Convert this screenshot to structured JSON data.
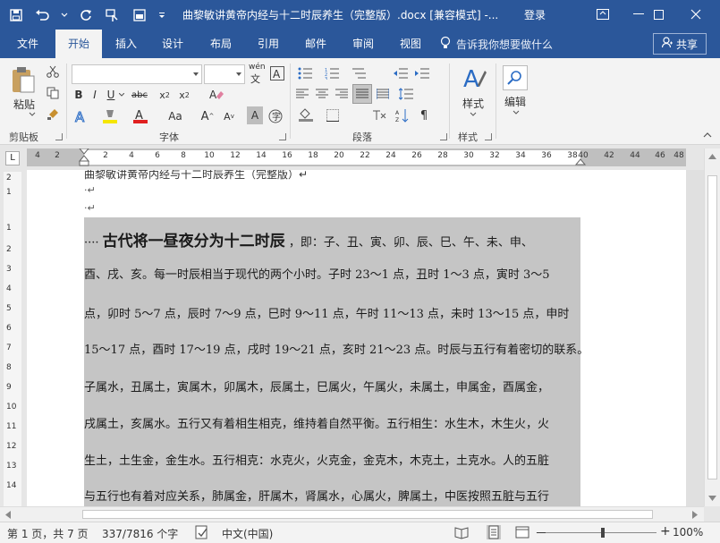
{
  "window": {
    "title": "曲黎敏讲黄帝内经与十二时辰养生（完整版）.docx [兼容模式] -...",
    "login": "登录"
  },
  "ribbon_tabs": [
    "文件",
    "开始",
    "插入",
    "设计",
    "布局",
    "引用",
    "邮件",
    "审阅",
    "视图"
  ],
  "active_tab": "开始",
  "tell_me": "告诉我你想要做什么",
  "share": "共享",
  "groups": {
    "clipboard": {
      "label": "剪贴板",
      "paste": "粘贴"
    },
    "font": {
      "label": "字体",
      "wen": "wén"
    },
    "paragraph": {
      "label": "段落"
    },
    "styles": {
      "label": "样式",
      "button": "样式"
    },
    "editing": {
      "button": "编辑"
    }
  },
  "ruler": {
    "corner": "L",
    "h_left": [
      "4",
      "2"
    ],
    "h_main": [
      "2",
      "4",
      "6",
      "8",
      "10",
      "12",
      "14",
      "16",
      "18",
      "20",
      "22",
      "24",
      "26",
      "28",
      "30",
      "32",
      "34",
      "36",
      "38"
    ],
    "h_right": [
      "40",
      "42",
      "44",
      "46",
      "48"
    ],
    "v": [
      "2",
      "1",
      "1",
      "2",
      "3",
      "4",
      "5",
      "6",
      "7",
      "8",
      "9",
      "10",
      "11",
      "12",
      "13",
      "14"
    ]
  },
  "document": {
    "header_text": "曲黎敏讲黄帝内经与十二时辰养生（完整版）↵",
    "empty_marks": [
      "·↵",
      "·↵"
    ],
    "lines": [
      {
        "lead": "····",
        "big": "古代将一昼夜分为十二时辰",
        "rest": "，即：子、丑、寅、卯、辰、巳、午、未、申、"
      },
      {
        "text": "酉、戌、亥。每一时辰相当于现代的两个小时。子时 23～1 点，丑时 1～3 点，寅时 3～5"
      },
      {
        "text": "点，卯时 5～7 点，辰时 7～9 点，巳时 9～11 点，午时 11～13 点，未时 13～15 点，申时"
      },
      {
        "text": "15～17 点，酉时 17～19 点，戌时 19～21 点，亥时 21～23 点。时辰与五行有着密切的联系。"
      },
      {
        "text": "子属水，丑属土，寅属木，卯属木，辰属土，巳属火，午属火，未属土，申属金，酉属金，"
      },
      {
        "text": "戌属土，亥属水。五行又有着相生相克，维持着自然平衡。五行相生：水生木，木生火，火"
      },
      {
        "text": "生土，土生金，金生水。五行相克：水克火，火克金，金克木，木克土，土克水。人的五脏"
      },
      {
        "text": "与五行也有着对应关系，肺属金，肝属木，肾属水，心属火，脾属土，中医按照五脏与五行"
      }
    ]
  },
  "status": {
    "page": "第 1 页，共 7 页",
    "words": "337/7816 个字",
    "language": "中文(中国)",
    "zoom": "100%",
    "zoom_percent": 100,
    "minus": "－",
    "plus": "+"
  },
  "colors": {
    "brand": "#2b579a",
    "selection": "#c5c5c5",
    "font_color_red": "#e02020",
    "highlight_yellow": "#f5e600"
  }
}
